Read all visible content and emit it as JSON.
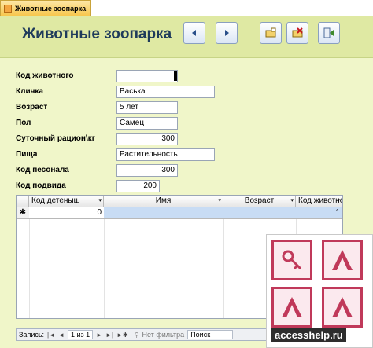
{
  "tab": {
    "label": "Животные зоопарка",
    "icon": "form-icon"
  },
  "header": {
    "title": "Животные зоопарка"
  },
  "toolbar": {
    "prev_icon": "arrow-left-icon",
    "next_icon": "arrow-right-icon",
    "new_icon": "new-record-icon",
    "delete_icon": "delete-record-icon",
    "close_icon": "close-form-icon"
  },
  "form": {
    "animal_code_label": "Код животного",
    "animal_code_value": "",
    "nickname_label": "Кличка",
    "nickname_value": "Васька",
    "age_label": "Возраст",
    "age_value": "5 лет",
    "sex_label": "Пол",
    "sex_value": "Самец",
    "ration_label": "Суточный рацион\\кг",
    "ration_value": "300",
    "food_label": "Пища",
    "food_value": "Растительность",
    "keeper_label": "Код песонала",
    "keeper_value": "300",
    "species_label": "Код подвида",
    "species_value": "200"
  },
  "subgrid": {
    "headers": [
      "Код детеныш",
      "Имя",
      "Возраст",
      "Код животно"
    ],
    "new_row": {
      "marker": "✱",
      "code": "0",
      "name": "",
      "age": "",
      "animal": "1"
    }
  },
  "navbar": {
    "records_label": "Запись:",
    "position": "1 из 1",
    "filter_label": "Нет фильтра",
    "search_label": "Поиск"
  },
  "watermark": {
    "site": "accesshelp.ru"
  },
  "colors": {
    "header_bg": "#dfe9a3",
    "body_bg": "#f0f6c9",
    "title_color": "#1f3b5b",
    "logo_accent": "#c0395a"
  }
}
